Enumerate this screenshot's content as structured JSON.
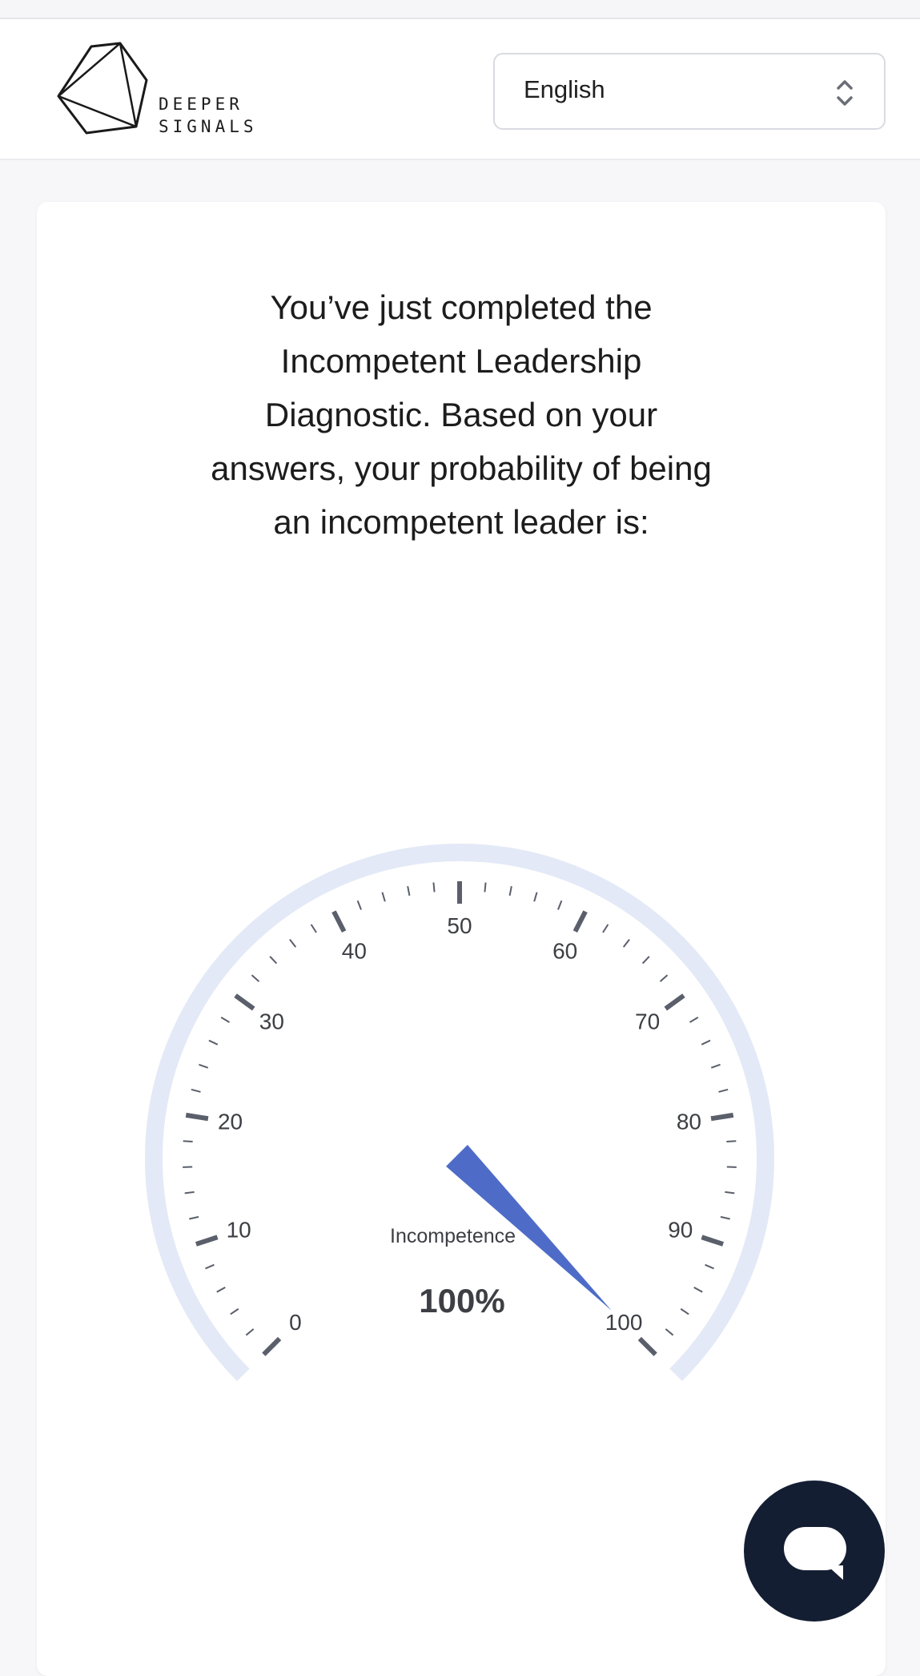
{
  "brand": {
    "line1": "DEEPER",
    "line2": "SIGNALS",
    "icon": "hexagon-logo-icon"
  },
  "language_select": {
    "value": "English",
    "icon": "chevron-up-down-icon"
  },
  "result": {
    "message": "You’ve just completed the Incompetent Leadership Diagnostic. Based on your answers, your probability of being an incompetent leader is:"
  },
  "gauge": {
    "value": 100,
    "min": 0,
    "max": 100,
    "label": "Incompetence",
    "value_text": "100%",
    "tick_labels": [
      "0",
      "10",
      "20",
      "30",
      "40",
      "50",
      "60",
      "70",
      "80",
      "90",
      "100"
    ],
    "colors": {
      "track": "#e3e9f6",
      "needle": "#4e6cc7",
      "ticks": "#5a5f6b",
      "text": "#3d3f44"
    }
  },
  "chat": {
    "icon": "chat-bubble-icon",
    "color": "#141e33"
  }
}
